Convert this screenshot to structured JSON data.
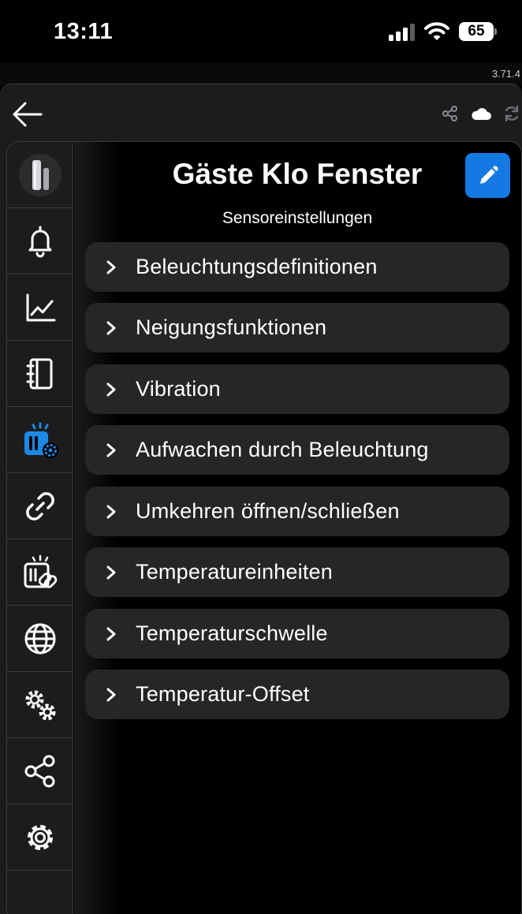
{
  "status": {
    "time": "13:11",
    "battery": "65"
  },
  "app": {
    "version": "3.71.4"
  },
  "header": {
    "back_icon": "arrow-left-icon",
    "icons": [
      "share-icon",
      "cloud-icon",
      "sync-icon"
    ]
  },
  "page": {
    "title": "Gäste Klo Fenster",
    "subtitle": "Sensoreinstellungen",
    "accent": "#1479e3"
  },
  "sidebar": {
    "items": [
      {
        "icon": "door-sensor-icon",
        "active": false
      },
      {
        "icon": "bell-icon",
        "active": false
      },
      {
        "icon": "chart-icon",
        "active": false
      },
      {
        "icon": "notebook-icon",
        "active": false
      },
      {
        "icon": "sensor-settings-icon",
        "active": true
      },
      {
        "icon": "link-icon",
        "active": false
      },
      {
        "icon": "sensor-link-icon",
        "active": false
      },
      {
        "icon": "globe-icon",
        "active": false
      },
      {
        "icon": "gears-icon",
        "active": false
      },
      {
        "icon": "share-icon",
        "active": false
      },
      {
        "icon": "gear-icon",
        "active": false
      }
    ]
  },
  "menu": {
    "items": [
      {
        "label": "Beleuchtungsdefinitionen"
      },
      {
        "label": "Neigungsfunktionen"
      },
      {
        "label": "Vibration"
      },
      {
        "label": "Aufwachen durch Beleuchtung"
      },
      {
        "label": "Umkehren öffnen/schließen"
      },
      {
        "label": "Temperatureinheiten"
      },
      {
        "label": "Temperaturschwelle"
      },
      {
        "label": "Temperatur-Offset"
      }
    ]
  }
}
